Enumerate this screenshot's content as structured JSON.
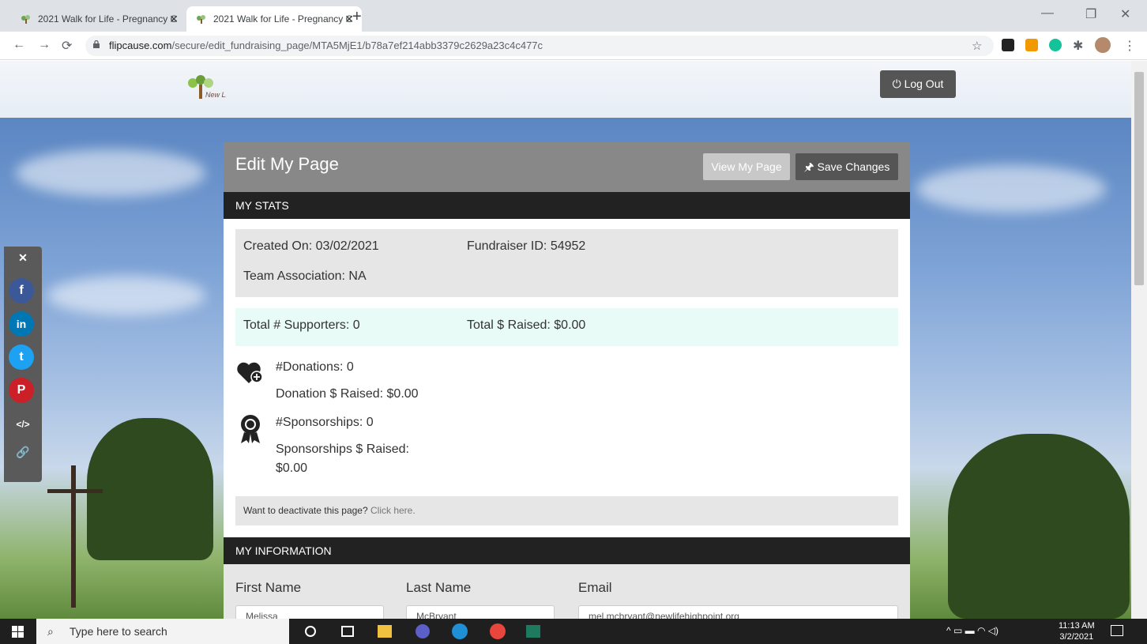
{
  "browser": {
    "tabs": [
      {
        "title": "2021 Walk for Life - Pregnancy C",
        "active": false
      },
      {
        "title": "2021 Walk for Life - Pregnancy C",
        "active": true
      }
    ],
    "new_tab": "+",
    "url_host": "flipcause.com",
    "url_path": "/secure/edit_fundraising_page/MTA5MjE1/b78a7ef214abb3379c2629a23c4c477c",
    "window_controls": {
      "minimize": "—",
      "restore": "❐",
      "close": "✕"
    }
  },
  "header": {
    "logout_label": "Log Out"
  },
  "social": {
    "close": "✕",
    "facebook": "f",
    "linkedin": "in",
    "twitter": "t",
    "pinterest": "P",
    "embed": "</>",
    "link": "🔗"
  },
  "card": {
    "title": "Edit My Page",
    "view_label": "View My Page",
    "save_label": "Save Changes"
  },
  "stats": {
    "section_title": "MY STATS",
    "created_on": "Created On: 03/02/2021",
    "fundraiser_id": "Fundraiser ID: 54952",
    "team_association": "Team Association: NA",
    "total_supporters": "Total # Supporters: 0",
    "total_raised": "Total $ Raised: $0.00",
    "donations": "#Donations: 0",
    "donation_raised": "Donation $ Raised: $0.00",
    "sponsorships": "#Sponsorships: 0",
    "sponsorships_raised_label": "Sponsorships $ Raised:",
    "sponsorships_raised_value": "$0.00",
    "deactivate_text": "Want to deactivate this page?",
    "deactivate_link": "Click here."
  },
  "info": {
    "section_title": "MY INFORMATION",
    "first_name_label": "First Name",
    "last_name_label": "Last Name",
    "email_label": "Email",
    "first_name_value": "Melissa",
    "last_name_value": "McBryant",
    "email_value": "mel.mcbryant@newlifehighpoint.org"
  },
  "taskbar": {
    "search_placeholder": "Type here to search",
    "time": "11:13 AM",
    "date": "3/2/2021"
  },
  "colors": {
    "card_header": "#888888",
    "section_bar": "#222222",
    "save_button": "#555555",
    "supporters_bg": "#e9fbf6"
  }
}
